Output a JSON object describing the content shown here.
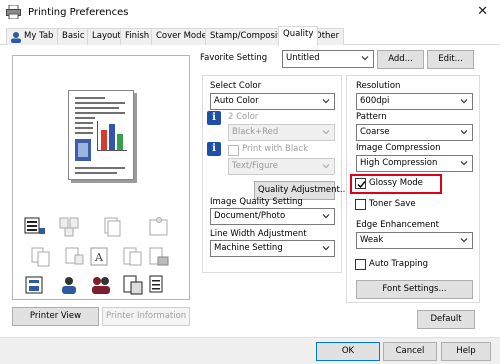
{
  "window": {
    "title": "Printing Preferences",
    "close_glyph": "✕"
  },
  "tabs": [
    "My Tab",
    "Basic",
    "Layout",
    "Finish",
    "Cover Mode",
    "Stamp/Composition",
    "Quality",
    "Other"
  ],
  "active_tab": "Quality",
  "favorite": {
    "label": "Favorite Setting",
    "value": "Untitled",
    "add_label": "Add...",
    "edit_label": "Edit..."
  },
  "preview": {
    "printer_view_label": "Printer View",
    "printer_information_label": "Printer Information"
  },
  "select_color": {
    "label": "Select Color",
    "value": "Auto Color",
    "two_color_label": "2 Color",
    "two_color_value": "Black+Red",
    "print_with_black_label": "Print with Black",
    "print_with_black_value": "Text/Figure",
    "quality_adjustment_label": "Quality Adjustment..."
  },
  "image_quality": {
    "label": "Image Quality Setting",
    "value": "Document/Photo"
  },
  "line_width": {
    "label": "Line Width Adjustment",
    "value": "Machine Setting"
  },
  "resolution": {
    "label": "Resolution",
    "value": "600dpi"
  },
  "pattern": {
    "label": "Pattern",
    "value": "Coarse"
  },
  "image_compression": {
    "label": "Image Compression",
    "value": "High Compression"
  },
  "glossy_mode": {
    "label": "Glossy Mode",
    "checked": true
  },
  "toner_save": {
    "label": "Toner Save",
    "checked": false
  },
  "edge_enhancement": {
    "label": "Edge Enhancement",
    "value": "Weak"
  },
  "auto_trapping": {
    "label": "Auto Trapping",
    "checked": false
  },
  "font_settings_label": "Font Settings...",
  "default_label": "Default",
  "footer": {
    "ok": "OK",
    "cancel": "Cancel",
    "help": "Help"
  },
  "colors": {
    "highlight": "#e0001a",
    "accent": "#0078d7",
    "info_icon": "#1f4fa8"
  }
}
